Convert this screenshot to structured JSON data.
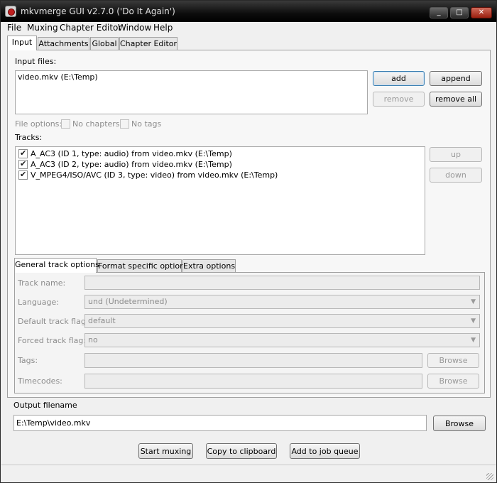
{
  "window": {
    "title": "mkvmerge GUI v2.7.0 ('Do It Again')",
    "controls": [
      "_",
      "□",
      "✕"
    ]
  },
  "menu": [
    "File",
    "Muxing",
    "Chapter Editor",
    "Window",
    "Help"
  ],
  "main_tabs": [
    "Input",
    "Attachments",
    "Global",
    "Chapter Editor"
  ],
  "input": {
    "input_files_label": "Input files:",
    "files": [
      "video.mkv (E:\\Temp)"
    ],
    "add_label": "add",
    "append_label": "append",
    "remove_label": "remove",
    "remove_all_label": "remove all",
    "file_options_label": "File options:",
    "no_chapters_label": "No chapters",
    "no_tags_label": "No tags",
    "tracks_label": "Tracks:",
    "tracks": [
      {
        "text": "A_AC3 (ID 1, type: audio) from video.mkv (E:\\Temp)",
        "checked": true
      },
      {
        "text": "A_AC3 (ID 2, type: audio) from video.mkv (E:\\Temp)",
        "checked": true
      },
      {
        "text": "V_MPEG4/ISO/AVC (ID 3, type: video) from video.mkv (E:\\Temp)",
        "checked": true
      }
    ],
    "up_label": "up",
    "down_label": "down"
  },
  "sub_tabs": [
    "General track options",
    "Format specific options",
    "Extra options"
  ],
  "track_options": {
    "track_name_label": "Track name:",
    "track_name_value": "",
    "language_label": "Language:",
    "language_value": "und (Undetermined)",
    "default_flag_label": "Default track flag:",
    "default_flag_value": "default",
    "forced_flag_label": "Forced track flag:",
    "forced_flag_value": "no",
    "tags_label": "Tags:",
    "tags_value": "",
    "timecodes_label": "Timecodes:",
    "timecodes_value": "",
    "browse_label": "Browse"
  },
  "output": {
    "label": "Output filename",
    "value": "E:\\Temp\\video.mkv",
    "browse_label": "Browse"
  },
  "actions": {
    "start_label": "Start muxing",
    "copy_label": "Copy to clipboard",
    "queue_label": "Add to job queue"
  }
}
